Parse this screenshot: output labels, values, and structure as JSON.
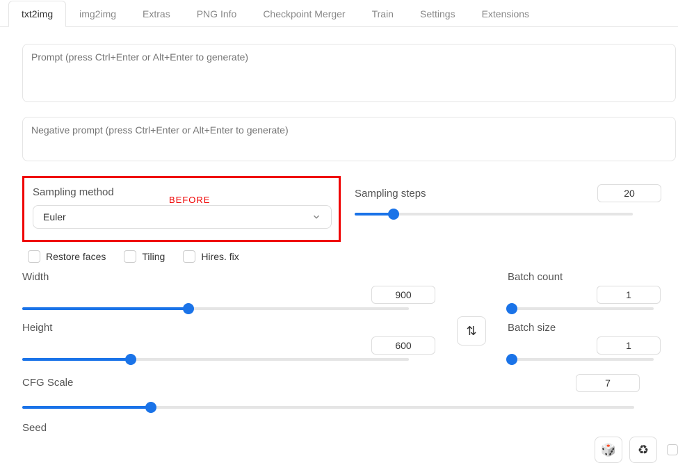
{
  "tabs": {
    "items": [
      "txt2img",
      "img2img",
      "Extras",
      "PNG Info",
      "Checkpoint Merger",
      "Train",
      "Settings",
      "Extensions"
    ],
    "active_index": 0
  },
  "prompt": {
    "placeholder": "Prompt (press Ctrl+Enter or Alt+Enter to generate)",
    "value": ""
  },
  "negative_prompt": {
    "placeholder": "Negative prompt (press Ctrl+Enter or Alt+Enter to generate)",
    "value": ""
  },
  "annotation": {
    "before": "BEFORE"
  },
  "sampling_method": {
    "label": "Sampling method",
    "selected": "Euler"
  },
  "sampling_steps": {
    "label": "Sampling steps",
    "value": "20",
    "fill_pct": 14
  },
  "checkboxes": {
    "restore_faces": "Restore faces",
    "tiling": "Tiling",
    "hires_fix": "Hires. fix"
  },
  "width": {
    "label": "Width",
    "value": "900",
    "fill_pct": 43
  },
  "height": {
    "label": "Height",
    "value": "600",
    "fill_pct": 28
  },
  "batch_count": {
    "label": "Batch count",
    "value": "1",
    "fill_pct": 3
  },
  "batch_size": {
    "label": "Batch size",
    "value": "1",
    "fill_pct": 3
  },
  "cfg_scale": {
    "label": "CFG Scale",
    "value": "7",
    "fill_pct": 21
  },
  "seed": {
    "label": "Seed"
  },
  "icons": {
    "swap": "⇅",
    "dice": "🎲",
    "recycle": "♻",
    "chevron": "v"
  },
  "colors": {
    "accent": "#1a73e8",
    "highlight": "#ef0000"
  }
}
